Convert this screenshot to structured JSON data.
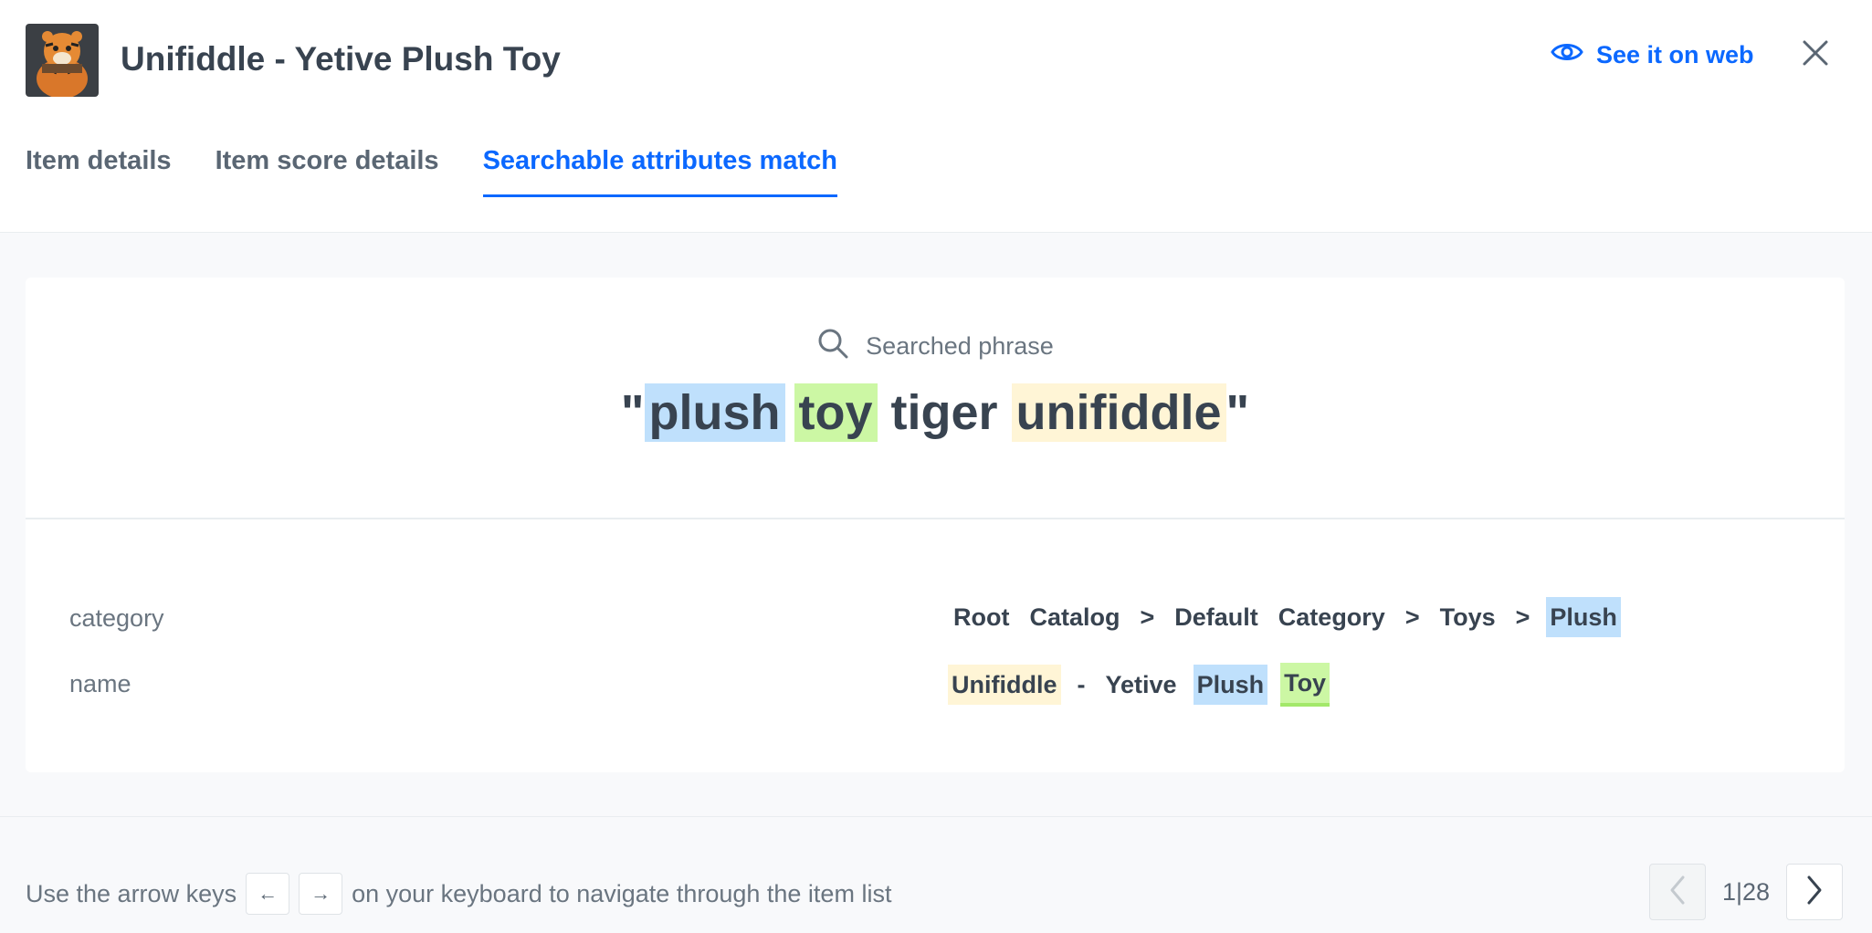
{
  "header": {
    "title": "Unifiddle - Yetive Plush Toy",
    "see_web_label": "See it on web"
  },
  "tabs": [
    {
      "label": "Item details",
      "active": false
    },
    {
      "label": "Item score details",
      "active": false
    },
    {
      "label": "Searchable attributes match",
      "active": true
    }
  ],
  "search": {
    "label": "Searched phrase",
    "open_quote": "\"",
    "close_quote": "\"",
    "words": [
      {
        "text": "plush",
        "highlight": "blue"
      },
      {
        "text": "toy",
        "highlight": "green"
      },
      {
        "text": "tiger",
        "highlight": "none"
      },
      {
        "text": "unifiddle",
        "highlight": "yellow"
      }
    ]
  },
  "attributes": [
    {
      "key": "category",
      "tokens": [
        {
          "text": "Root",
          "highlight": "none"
        },
        {
          "text": "Catalog",
          "highlight": "none"
        },
        {
          "text": ">",
          "highlight": "sep"
        },
        {
          "text": "Default",
          "highlight": "none"
        },
        {
          "text": "Category",
          "highlight": "none"
        },
        {
          "text": ">",
          "highlight": "sep"
        },
        {
          "text": "Toys",
          "highlight": "none"
        },
        {
          "text": ">",
          "highlight": "sep"
        },
        {
          "text": "Plush",
          "highlight": "blue"
        }
      ]
    },
    {
      "key": "name",
      "tokens": [
        {
          "text": "Unifiddle",
          "highlight": "yellow"
        },
        {
          "text": "-",
          "highlight": "sep"
        },
        {
          "text": "Yetive",
          "highlight": "none"
        },
        {
          "text": "Plush",
          "highlight": "blue"
        },
        {
          "text": "Toy",
          "highlight": "green"
        }
      ]
    }
  ],
  "footer": {
    "text_before": "Use the arrow keys",
    "key_left": "←",
    "key_right": "→",
    "text_after": "on your keyboard to navigate through the item list"
  },
  "pager": {
    "count": "1|28"
  },
  "colors": {
    "accent": "#0b68ff",
    "highlight_blue": "#bfe0fc",
    "highlight_green": "#ccf7a4",
    "highlight_yellow": "#fff5d6"
  }
}
